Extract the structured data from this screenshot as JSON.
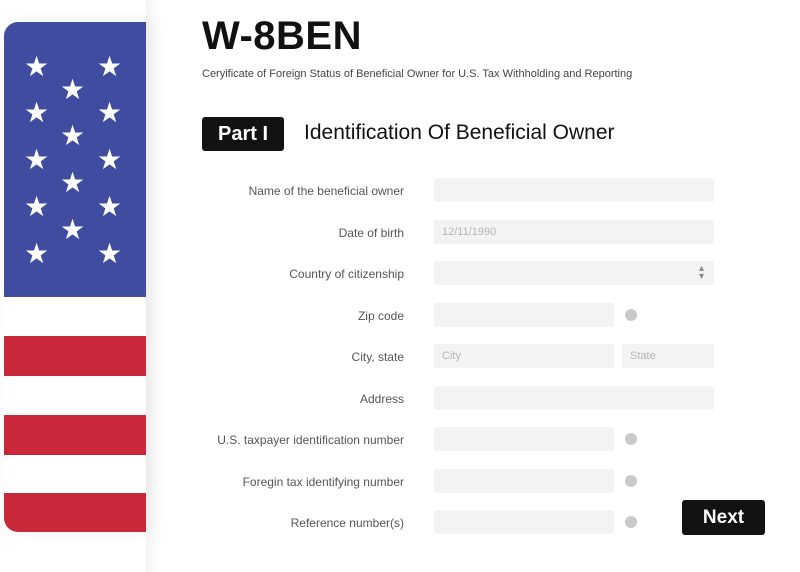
{
  "header": {
    "title": "W-8BEN",
    "subtitle": "Ceryificate of Foreign Status of Beneficial Owner for U.S. Tax Withholding and Reporting"
  },
  "part": {
    "badge": "Part I",
    "title": "Identification Of Beneficial Owner"
  },
  "form": {
    "name_label": "Name of the beneficial owner",
    "name_value": "",
    "dob_label": "Date of birth",
    "dob_value": "12/11/1990",
    "citizenship_label": "Country of citizenship",
    "citizenship_value": "",
    "zip_label": "Zip code",
    "zip_value": "",
    "city_state_label": "City, state",
    "city_placeholder": "City",
    "state_placeholder": "State",
    "address_label": "Address",
    "address_value": "",
    "us_tin_label": "U.S. taxpayer identification number",
    "us_tin_value": "",
    "foreign_tin_label": "Foregin tax identifying number",
    "foreign_tin_value": "",
    "reference_label": "Reference number(s)",
    "reference_value": ""
  },
  "buttons": {
    "next_label": "Next"
  },
  "icons": {
    "flag": "us-flag-icon",
    "info": "info-icon",
    "select": "select-arrows-icon"
  },
  "colors": {
    "flag_blue": "#3f4ca0",
    "flag_red": "#c8283a",
    "button_bg": "#121212",
    "field_bg": "#f3f3f3"
  }
}
